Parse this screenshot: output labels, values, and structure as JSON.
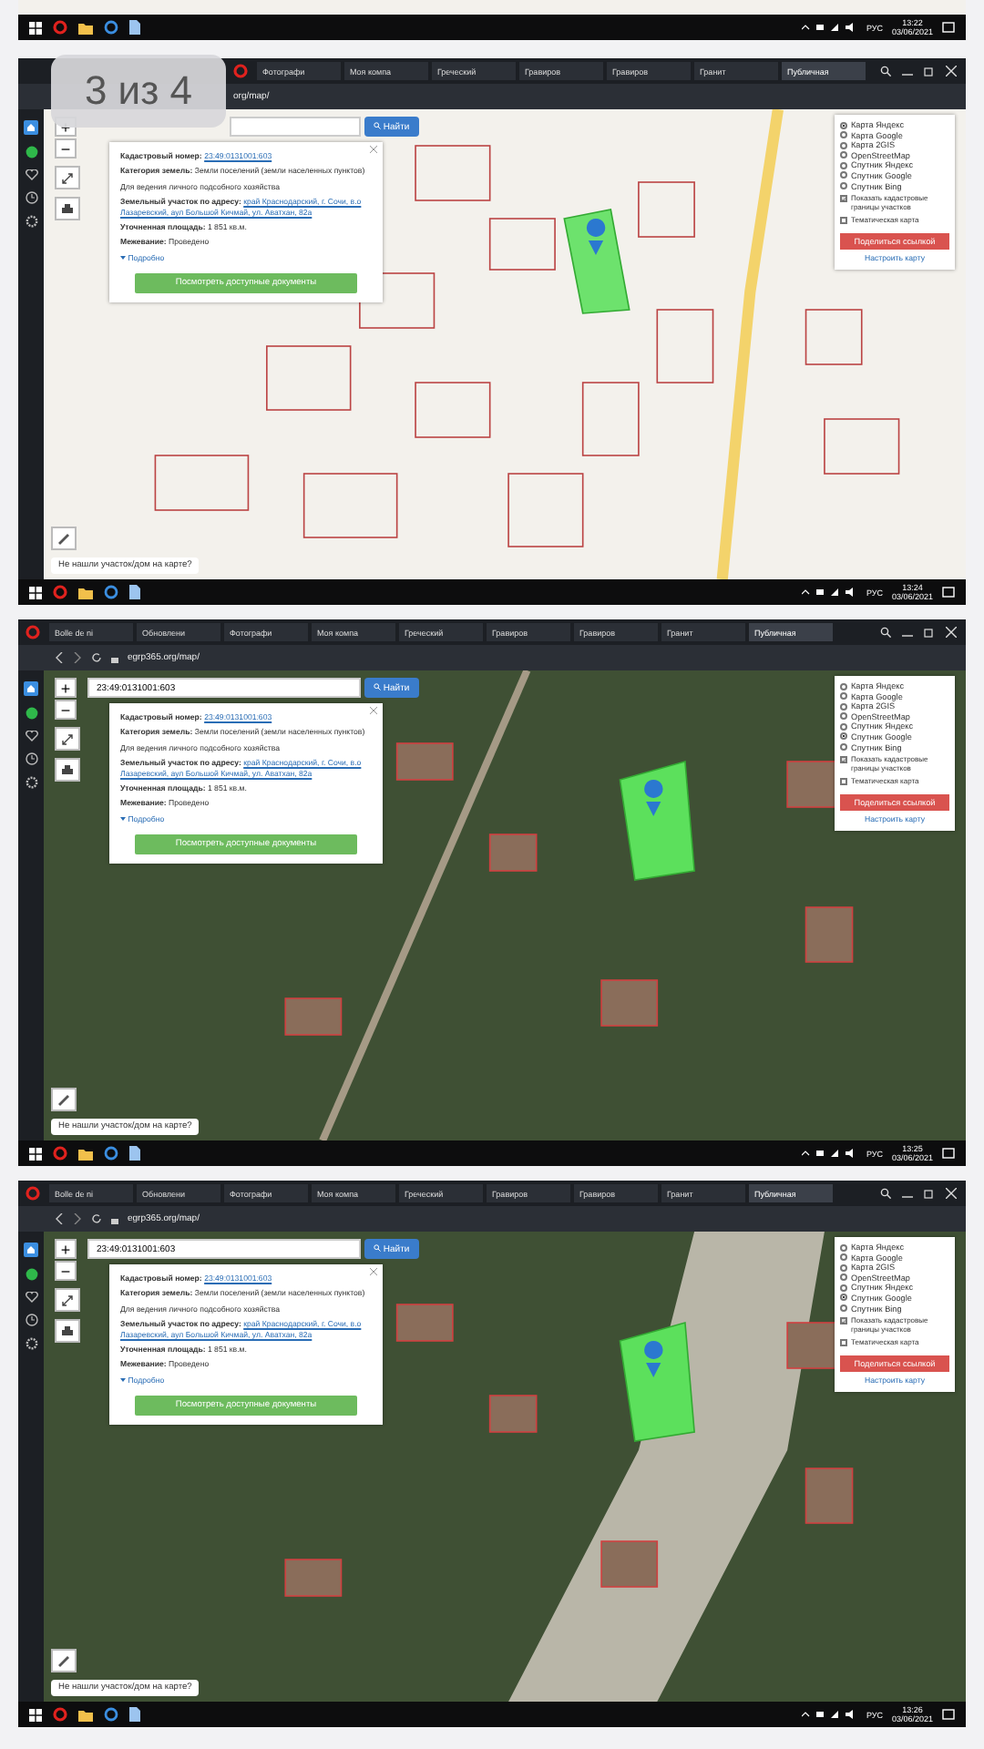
{
  "viewer": {
    "counter": "3 из 4"
  },
  "previous_screenshot": {
    "map": {
      "kind": "scheme"
    },
    "taskbar": {
      "language": "РУС",
      "time": "13:22",
      "date": "03/06/2021"
    }
  },
  "screenshots": [
    {
      "tabs": [
        {
          "label": "Фотографи",
          "selected": false
        },
        {
          "label": "Моя компа",
          "selected": false
        },
        {
          "label": "Греческий",
          "selected": false
        },
        {
          "label": "Гравиров",
          "selected": false
        },
        {
          "label": "Гравиров",
          "selected": false
        },
        {
          "label": "Гранит",
          "selected": false
        },
        {
          "label": "Публичная",
          "selected": true
        }
      ],
      "address": "org/map/",
      "search": {
        "button": "Найти"
      },
      "map": {
        "kind": "scheme"
      },
      "zoom_buttons": [
        "+",
        "−"
      ],
      "info_card": {
        "rows": [
          {
            "label": "Кадастровый номер:",
            "value": "23:49:0131001:603",
            "kind": "link"
          },
          {
            "label": "Категория земель:",
            "value": "Земли поселений (земли населенных пунктов)",
            "kind": "text"
          },
          {
            "label": "",
            "value": "Для ведения личного подсобного хозяйства",
            "kind": "text"
          },
          {
            "label": "Земельный участок по адресу:",
            "value": "край Краснодарский, г. Сочи, в.о Лазаревский, аул Большой Кичмай, ул. Аватхан, 82а",
            "kind": "link"
          },
          {
            "label": "Уточненная площадь:",
            "value": "1 851 кв.м.",
            "kind": "text"
          },
          {
            "label": "Межевание:",
            "value": "Проведено",
            "kind": "text"
          }
        ],
        "details": "Подробно",
        "button": "Посмотреть доступные документы"
      },
      "layers": {
        "options": [
          {
            "label": "Карта Яндекс",
            "selected": true
          },
          {
            "label": "Карта Google",
            "selected": false
          },
          {
            "label": "Карта 2GIS",
            "selected": false
          },
          {
            "label": "OpenStreetMap",
            "selected": false
          },
          {
            "label": "Спутник Яндекс",
            "selected": false
          },
          {
            "label": "Спутник Google",
            "selected": false
          },
          {
            "label": "Спутник Bing",
            "selected": false
          }
        ],
        "checks": [
          {
            "label": "Показать кадастровые границы участков",
            "checked": true
          },
          {
            "label": "Тематическая карта",
            "checked": false
          }
        ],
        "share_button": "Поделиться ссылкой",
        "settings_link": "Настроить карту"
      },
      "prompt": "Не нашли участок/дом на карте?",
      "taskbar": {
        "language": "РУС",
        "time": "13:24",
        "date": "03/06/2021"
      }
    },
    {
      "tabs": [
        {
          "label": "Bolle de ni",
          "selected": false
        },
        {
          "label": "Обновлени",
          "selected": false
        },
        {
          "label": "Фотографи",
          "selected": false
        },
        {
          "label": "Моя компа",
          "selected": false
        },
        {
          "label": "Греческий",
          "selected": false
        },
        {
          "label": "Гравиров",
          "selected": false
        },
        {
          "label": "Гравиров",
          "selected": false
        },
        {
          "label": "Гранит",
          "selected": false
        },
        {
          "label": "Публичная",
          "selected": true
        }
      ],
      "address": "egrp365.org/map/",
      "search": {
        "value": "23:49:0131001:603",
        "button": "Найти"
      },
      "map": {
        "kind": "satellite"
      },
      "zoom_buttons": [
        "+",
        "−"
      ],
      "info_card": {
        "rows": [
          {
            "label": "Кадастровый номер:",
            "value": "23:49:0131001:603",
            "kind": "link"
          },
          {
            "label": "Категория земель:",
            "value": "Земли поселений (земли населенных пунктов)",
            "kind": "text"
          },
          {
            "label": "",
            "value": "Для ведения личного подсобного хозяйства",
            "kind": "text"
          },
          {
            "label": "Земельный участок по адресу:",
            "value": "край Краснодарский, г. Сочи, в.о Лазаревский, аул Большой Кичмай, ул. Аватхан, 82а",
            "kind": "link"
          },
          {
            "label": "Уточненная площадь:",
            "value": "1 851 кв.м.",
            "kind": "text"
          },
          {
            "label": "Межевание:",
            "value": "Проведено",
            "kind": "text"
          }
        ],
        "details": "Подробно",
        "button": "Посмотреть доступные документы"
      },
      "layers": {
        "options": [
          {
            "label": "Карта Яндекс",
            "selected": false
          },
          {
            "label": "Карта Google",
            "selected": false
          },
          {
            "label": "Карта 2GIS",
            "selected": false
          },
          {
            "label": "OpenStreetMap",
            "selected": false
          },
          {
            "label": "Спутник Яндекс",
            "selected": false
          },
          {
            "label": "Спутник Google",
            "selected": true
          },
          {
            "label": "Спутник Bing",
            "selected": false
          }
        ],
        "checks": [
          {
            "label": "Показать кадастровые границы участков",
            "checked": true
          },
          {
            "label": "Тематическая карта",
            "checked": false
          }
        ],
        "share_button": "Поделиться ссылкой",
        "settings_link": "Настроить карту"
      },
      "prompt": "Не нашли участок/дом на карте?",
      "taskbar": {
        "language": "РУС",
        "time": "13:25",
        "date": "03/06/2021"
      }
    },
    {
      "tabs": [
        {
          "label": "Bolle de ni",
          "selected": false
        },
        {
          "label": "Обновлени",
          "selected": false
        },
        {
          "label": "Фотографи",
          "selected": false
        },
        {
          "label": "Моя компа",
          "selected": false
        },
        {
          "label": "Греческий",
          "selected": false
        },
        {
          "label": "Гравиров",
          "selected": false
        },
        {
          "label": "Гравиров",
          "selected": false
        },
        {
          "label": "Гранит",
          "selected": false
        },
        {
          "label": "Публичная",
          "selected": true
        }
      ],
      "address": "egrp365.org/map/",
      "search": {
        "value": "23:49:0131001:603",
        "button": "Найти"
      },
      "map": {
        "kind": "satellite"
      },
      "zoom_buttons": [
        "+",
        "−"
      ],
      "info_card": {
        "rows": [
          {
            "label": "Кадастровый номер:",
            "value": "23:49:0131001:603",
            "kind": "link"
          },
          {
            "label": "Категория земель:",
            "value": "Земли поселений (земли населенных пунктов)",
            "kind": "text"
          },
          {
            "label": "",
            "value": "Для ведения личного подсобного хозяйства",
            "kind": "text"
          },
          {
            "label": "Земельный участок по адресу:",
            "value": "край Краснодарский, г. Сочи, в.о Лазаревский, аул Большой Кичмай, ул. Аватхан, 82а",
            "kind": "link"
          },
          {
            "label": "Уточненная площадь:",
            "value": "1 851 кв.м.",
            "kind": "text"
          },
          {
            "label": "Межевание:",
            "value": "Проведено",
            "kind": "text"
          }
        ],
        "details": "Подробно",
        "button": "Посмотреть доступные документы"
      },
      "layers": {
        "options": [
          {
            "label": "Карта Яндекс",
            "selected": false
          },
          {
            "label": "Карта Google",
            "selected": false
          },
          {
            "label": "Карта 2GIS",
            "selected": false
          },
          {
            "label": "OpenStreetMap",
            "selected": false
          },
          {
            "label": "Спутник Яндекс",
            "selected": false
          },
          {
            "label": "Спутник Google",
            "selected": true
          },
          {
            "label": "Спутник Bing",
            "selected": false
          }
        ],
        "checks": [
          {
            "label": "Показать кадастровые границы участков",
            "checked": true
          },
          {
            "label": "Тематическая карта",
            "checked": false
          }
        ],
        "share_button": "Поделиться ссылкой",
        "settings_link": "Настроить карту"
      },
      "prompt": "Не нашли участок/дом на карте?",
      "taskbar": {
        "language": "РУС",
        "time": "13:26",
        "date": "03/06/2021"
      }
    }
  ]
}
